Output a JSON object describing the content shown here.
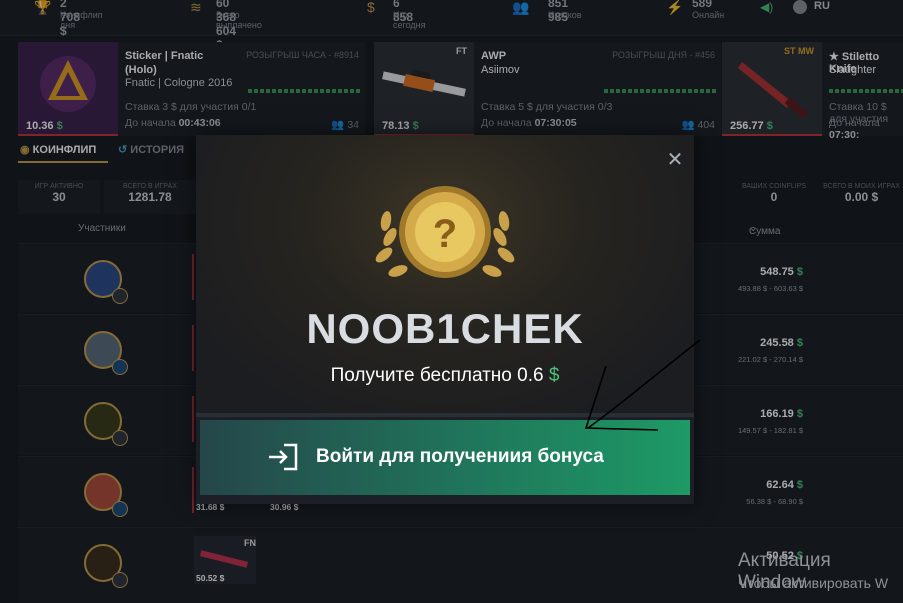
{
  "stats": [
    {
      "icon": "trophy-icon",
      "value": "2 708 $",
      "label": "Коинфлип дня"
    },
    {
      "icon": "money-icon",
      "value": "60 368 604 $",
      "label": "Всего выплачено"
    },
    {
      "icon": "coin-icon",
      "value": "6 858",
      "label": "Игр сегодня"
    },
    {
      "icon": "users-icon",
      "value": "851 985",
      "label": "Игроков"
    },
    {
      "icon": "online-icon",
      "value": "589",
      "label": "Онлайн"
    }
  ],
  "lang": "RU",
  "giveaways": [
    {
      "title1": "Sticker | Fnatic",
      "title2": "(Holo)",
      "title3": "Fnatic | Cologne 2016",
      "raffle": "РОЗЫГРЫШ ЧАСА - #8914",
      "price": "10.36",
      "bet": "Ставка 3 $ для участия 0/1",
      "start_label": "До начала",
      "start_time": "00:43:06",
      "users": "34",
      "tag": ""
    },
    {
      "title1": "AWP",
      "title2": "Asiimov",
      "title3": "",
      "raffle": "РОЗЫГРЫШ ДНЯ - #456",
      "price": "78.13",
      "bet": "Ставка 5 $ для участия 0/3",
      "start_label": "До начала",
      "start_time": "07:30:05",
      "users": "404",
      "tag": "FT"
    },
    {
      "title1": "★ Stiletto Knife",
      "title2": "Slaughter",
      "title3": "",
      "raffle": "",
      "price": "256.77",
      "bet": "Ставка 10 $ для участия",
      "start_label": "До начала",
      "start_time": "07:30:",
      "users": "",
      "tag": "ST MW"
    }
  ],
  "tabs": [
    {
      "label": "КОИНФЛИП",
      "icon": "coin-icon"
    },
    {
      "label": "ИСТОРИЯ",
      "icon": "history-icon"
    }
  ],
  "summary": [
    {
      "label": "ИГР АКТИВНО",
      "value": "30"
    },
    {
      "label": "ВСЕГО В ИГРАХ",
      "value": "1281.78"
    },
    {
      "label": "ВАШИХ COINFLIPS",
      "value": "0"
    },
    {
      "label": "ВСЕГО В МОИХ ИГРАХ",
      "value": "0.00 $"
    }
  ],
  "table": {
    "col_participants": "Участники",
    "col_sum": "Сумма",
    "rows": [
      {
        "sum": "548.75",
        "range": "493.88 $ - 603.63 $"
      },
      {
        "sum": "245.58",
        "range": "221.02 $ - 270.14 $"
      },
      {
        "sum": "166.19",
        "range": "149.57 $ - 182.81 $"
      },
      {
        "sum": "62.64",
        "range": "56.38 $ - 68.90 $",
        "items": [
          "31.68 $",
          "30.96 $"
        ]
      },
      {
        "sum": "50.52",
        "range": "",
        "items": [
          "50.52 $"
        ],
        "tag": "FN"
      }
    ]
  },
  "modal": {
    "nickname": "NOOB1CHEK",
    "offer_text": "Получите бесплатно 0.6",
    "offer_currency": "$",
    "button_label": "Войти для получениия бонуса"
  },
  "windows": {
    "line1": "Активация Window",
    "line2": "Чтобы активировать W"
  },
  "colors": {
    "accent": "#c8a04a",
    "green": "#4cc07a",
    "red": "#c0303a"
  }
}
